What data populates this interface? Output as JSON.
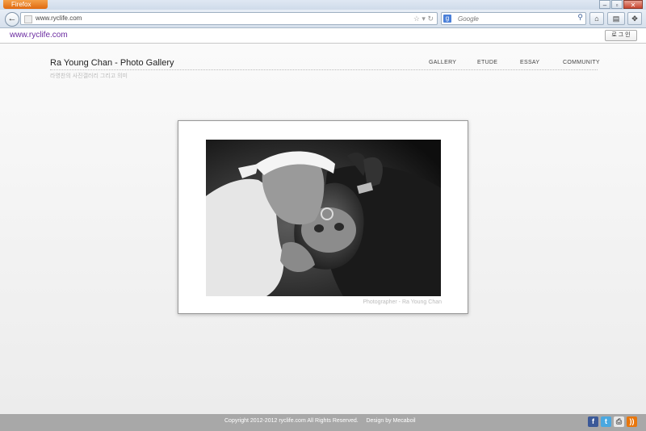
{
  "browser": {
    "menu_button": "Firefox",
    "url": "www.ryclife.com",
    "search_placeholder": "Google",
    "bookmark_brand": "www.ryclife.com",
    "login_button": "로 그 인"
  },
  "site": {
    "title": "Ra Young Chan - Photo Gallery",
    "subtitle": "라영찬의 사진갤러리 그리고 의미",
    "menu": [
      "GALLERY",
      "ETUDE",
      "ESSAY",
      "COMMUNITY"
    ]
  },
  "gallery": {
    "photo_credit": "Photographer - Ra Young Chan"
  },
  "footer": {
    "copyright": "Copyright 2012-2012 ryclife.com All Rights Reserved.",
    "design": "Design by Mecaboil",
    "social": [
      "facebook-icon",
      "twitter-icon",
      "print-icon",
      "rss-icon"
    ]
  },
  "colors": {
    "firefox_orange": "#e06a10",
    "brand_purple": "#6a2aa0",
    "footer_bg": "#a8a8a8"
  }
}
